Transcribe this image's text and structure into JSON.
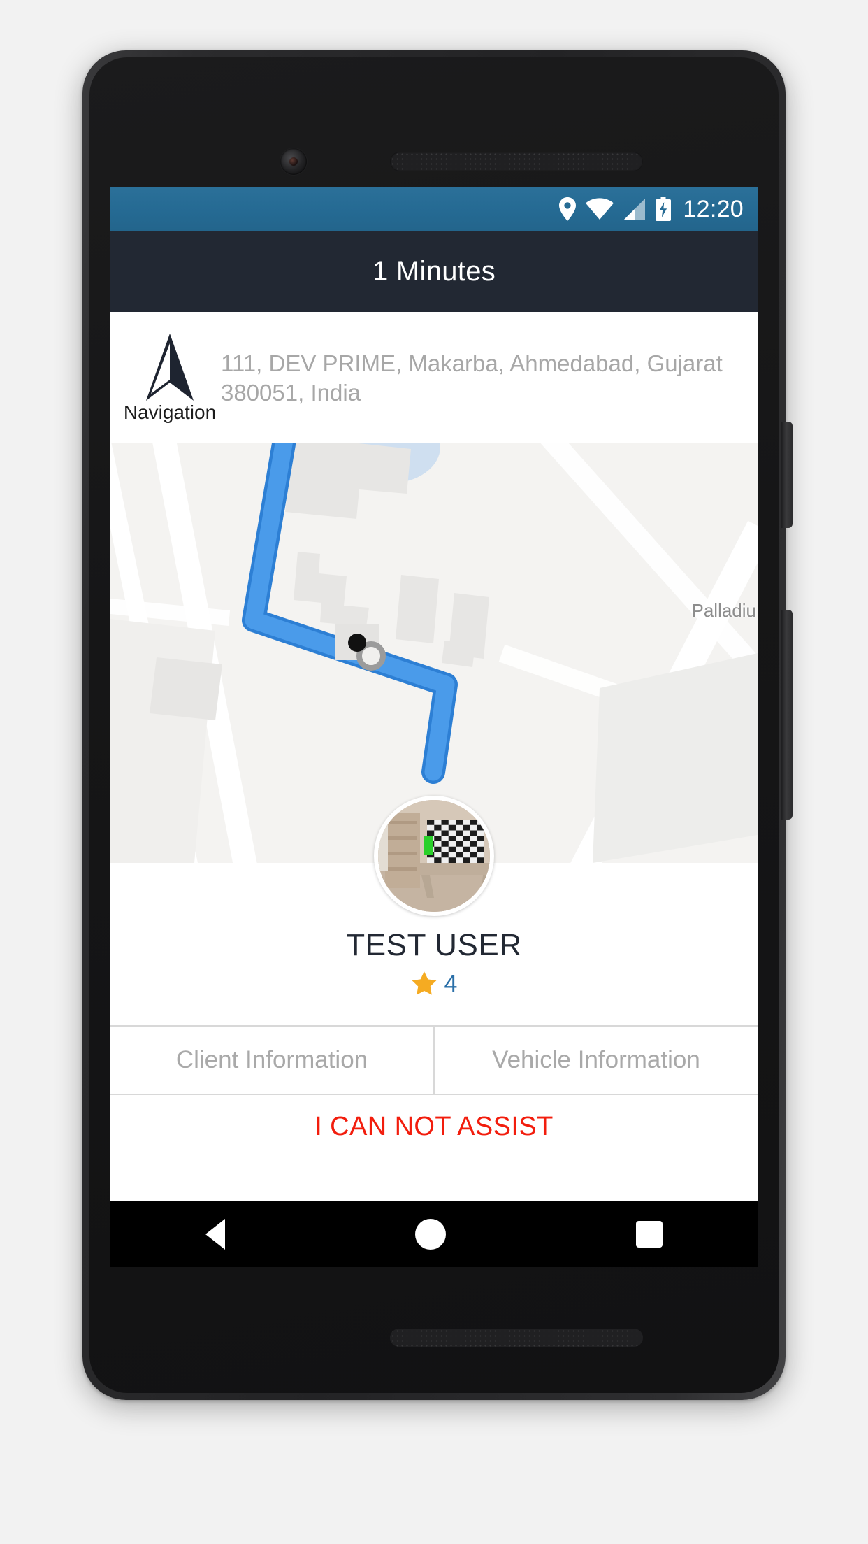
{
  "status_bar": {
    "time": "12:20",
    "icons": [
      "location-pin-icon",
      "wifi-icon",
      "signal-bars-icon",
      "battery-charging-icon"
    ],
    "background_color": "#256a93"
  },
  "title_bar": {
    "title": "1 Minutes",
    "background_color": "#222833"
  },
  "address_bar": {
    "navigation_label": "Navigation",
    "navigation_icon": "navigation-arrow-icon",
    "address": "111, DEV PRIME, Makarba, Ahmedabad, Gujarat 380051, India"
  },
  "map": {
    "label_palladium": "Palladiu",
    "route_color": "#4a9bea",
    "route_outline_color": "#2d7fd4",
    "background_color": "#f4f3f1",
    "destination_marker": "map-destination-dot",
    "route_endpoint": "route-endpoint-circle"
  },
  "user_card": {
    "avatar": "user-avatar-photo",
    "name": "TEST USER",
    "rating": "4",
    "rating_star_color": "#f5ab22",
    "rating_text_color": "#2a6fa8"
  },
  "tabs": [
    {
      "label": "Client Information",
      "name": "tab-client-information"
    },
    {
      "label": "Vehicle Information",
      "name": "tab-vehicle-information"
    }
  ],
  "action_button": {
    "label": "I CAN NOT ASSIST",
    "color": "#f21d0d"
  },
  "android_nav": {
    "back": "nav-back-icon",
    "home": "nav-home-icon",
    "recents": "nav-recents-icon"
  }
}
